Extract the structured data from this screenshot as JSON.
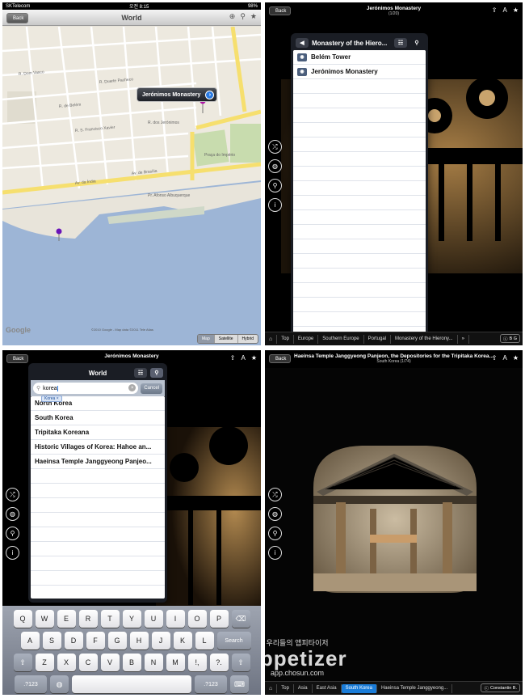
{
  "panel1": {
    "status": {
      "carrier": "SKTelecom",
      "time": "오전 8:15",
      "battery": "98%"
    },
    "nav": {
      "back": "Back",
      "title": "World"
    },
    "callout": "Jerónimos Monastery",
    "streets": [
      "R. dos Jerónimos",
      "Pr. Afonso Albuquerque",
      "Av. da Índia",
      "Av. de Brasília",
      "R. de Belém",
      "R. S. Francisco Xavier",
      "Praça do Império",
      "R. Dom Vasco",
      "R. Duarte Pacheco"
    ],
    "google": "Google",
    "attribution": "©2010 Google - Map data ©2011 Tele Atlas",
    "map_types": [
      "Map",
      "Satellite",
      "Hybrid"
    ]
  },
  "panel2": {
    "title": "Jerónimos Monastery",
    "subtitle": "(1/20)",
    "back": "Back",
    "popover_title": "Monastery of the Hiero...",
    "items": [
      "Belém Tower",
      "Jerónimos Monastery"
    ],
    "crumbs": [
      "Top",
      "Europe",
      "Southern Europe",
      "Portugal",
      "Monastery of the Hierony..."
    ],
    "credit": "B G"
  },
  "panel3": {
    "title": "Jerónimos Monastery",
    "back": "Back",
    "popover_title": "World",
    "search_value": "korea",
    "token": "Korea",
    "cancel": "Cancel",
    "results": [
      "North Korea",
      "South Korea",
      "Tripitaka Koreana",
      "Historic Villages of Korea: Hahoe an...",
      "Haeinsa Temple Janggyeong Panjeo..."
    ],
    "keys_row1": [
      "Q",
      "W",
      "E",
      "R",
      "T",
      "Y",
      "U",
      "I",
      "O",
      "P"
    ],
    "keys_row2": [
      "A",
      "S",
      "D",
      "F",
      "G",
      "H",
      "J",
      "K",
      "L"
    ],
    "keys_row3": [
      "Z",
      "X",
      "C",
      "V",
      "B",
      "N",
      "M",
      "!,",
      "?."
    ],
    "search_key": "Search",
    "num_key": ".?123"
  },
  "panel4": {
    "title": "Haeinsa Temple Janggyeong Panjeon, the Depositories for the Tripitaka Korea...",
    "subtitle": "South Korea (1/74)",
    "back": "Back",
    "crumbs": [
      "Top",
      "Asia",
      "East Asia",
      "South Korea",
      "Haeinsa Temple Janggyeong..."
    ],
    "credit": "Constantin B."
  },
  "watermark": {
    "korean": "우리들의 앱피타이저",
    "brand": "appetizer",
    "url": "app.chosun.com"
  }
}
